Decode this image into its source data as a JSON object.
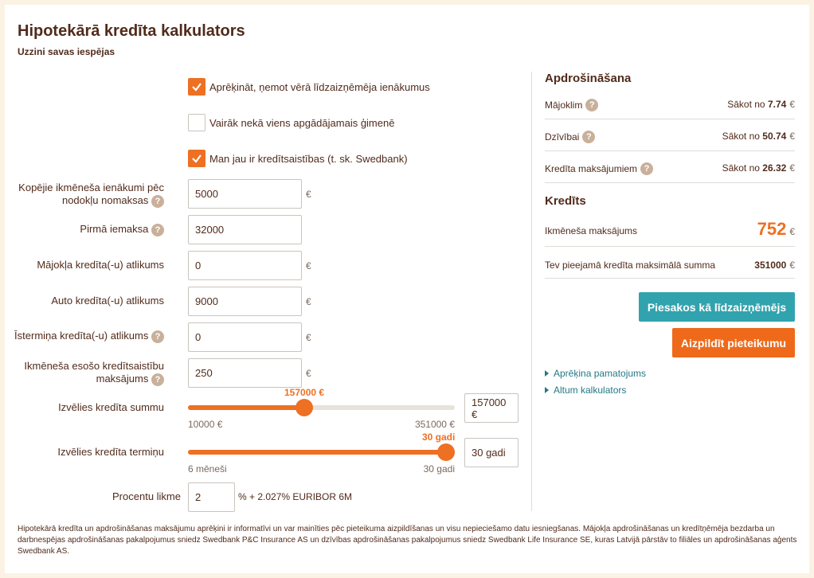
{
  "header": {
    "title": "Hipotekārā kredīta kalkulators",
    "subtitle": "Uzzini savas iespējas"
  },
  "checkboxes": [
    {
      "label": "Aprēķināt, ņemot vērā līdzaizņēmēja ienākumus",
      "checked": true
    },
    {
      "label": "Vairāk nekā viens apgādājamais ģimenē",
      "checked": false
    },
    {
      "label": "Man jau ir kredītsaistības (t. sk. Swedbank)",
      "checked": true
    }
  ],
  "fields": {
    "income": {
      "label": "Kopējie ikmēneša ienākumi pēc nodokļu nomaksas",
      "value": "5000",
      "unit": "€"
    },
    "down_payment": {
      "label": "Pirmā iemaksa",
      "value": "32000",
      "unit": ""
    },
    "home_loan": {
      "label": "Mājokļa kredīta(-u) atlikums",
      "value": "0",
      "unit": "€"
    },
    "car_loan": {
      "label": "Auto kredīta(-u) atlikums",
      "value": "9000",
      "unit": "€"
    },
    "short_loan": {
      "label": "Īstermiņa kredīta(-u) atlikums",
      "value": "0",
      "unit": "€"
    },
    "monthly_obligations": {
      "label": "Ikmēneša esošo kredītsaistību maksājums",
      "value": "250",
      "unit": "€"
    }
  },
  "sliders": {
    "amount": {
      "label": "Izvēlies kredīta summu",
      "current": "157000 €",
      "min_label": "10000 €",
      "max_label": "351000 €",
      "input": "157000 €",
      "fraction": 0.43
    },
    "term": {
      "label": "Izvēlies kredīta termiņu",
      "current": "30 gadi",
      "min_label": "6 mēneši",
      "max_label": "30 gadi",
      "input": "30 gadi",
      "fraction": 1.0
    }
  },
  "rate": {
    "label": "Procentu likme",
    "value": "2",
    "suffix": "% + 2.027% EURIBOR 6M"
  },
  "insurance": {
    "heading": "Apdrošināšana",
    "rows": [
      {
        "label": "Mājoklim",
        "prefix": "Sākot no",
        "value": "7.74",
        "unit": "€"
      },
      {
        "label": "Dzīvībai",
        "prefix": "Sākot no",
        "value": "50.74",
        "unit": "€"
      },
      {
        "label": "Kredīta maksājumiem",
        "prefix": "Sākot no",
        "value": "26.32",
        "unit": "€"
      }
    ]
  },
  "credit": {
    "heading": "Kredīts",
    "monthly_label": "Ikmēneša maksājums",
    "monthly_value": "752",
    "monthly_unit": "€",
    "max_label": "Tev pieejamā kredīta maksimālā summa",
    "max_value": "351000",
    "max_unit": "€"
  },
  "buttons": {
    "coborrower": "Piesakos kā līdzaizņēmējs",
    "apply": "Aizpildīt pieteikumu"
  },
  "links": {
    "calculation": "Aprēķina pamatojums",
    "alternative": "Altum kalkulators"
  },
  "footer": "Hipotekārā kredīta un apdrošināšanas maksājumu aprēķini ir informatīvi un var mainīties pēc pieteikuma aizpildīšanas un visu nepieciešamo datu iesniegšanas. Mājokļa apdrošināšanas un kredītņēmēja bezdarba un darbnespējas apdrošināšanas pakalpojumus sniedz Swedbank P&C Insurance AS un dzīvības apdrošināšanas pakalpojumus sniedz Swedbank Life Insurance SE, kuras Latvijā pārstāv to filiāles un apdrošināšanas aģents Swedbank AS.",
  "icons": {
    "help": "?",
    "check": "check-icon"
  },
  "colors": {
    "accent": "#ee7023",
    "teal": "#31a3ae",
    "text": "#512b1b"
  }
}
